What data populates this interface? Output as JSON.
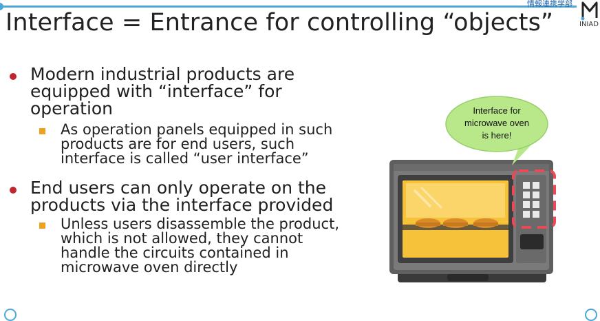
{
  "header": {
    "title": "Interface = Entrance for controlling “objects”",
    "corner_tag": "情報連携学部",
    "logo_text": "INIAD",
    "accent_color": "#4da6d8"
  },
  "bullets": [
    {
      "lines": [
        "Modern industrial products are",
        "equipped with “interface” for",
        "operation"
      ],
      "sub": {
        "lines": [
          "As operation panels equipped in such",
          "products are for end users, such",
          "interface is called “user interface”"
        ]
      }
    },
    {
      "lines": [
        "End users can only operate on the",
        "products via the interface provided"
      ],
      "sub": {
        "lines": [
          "Unless users disassemble the product,",
          "which is not allowed, they cannot",
          "handle the circuits contained in",
          "microwave oven directly"
        ]
      }
    }
  ],
  "illustration": {
    "callout_lines": [
      "Interface for",
      "microwave oven",
      "is here!"
    ],
    "callout_color": "#b8e88a",
    "highlight_color": "#e84a57",
    "icon": "microwave-oven-icon"
  },
  "colors": {
    "bullet_level1": "#c0262d",
    "bullet_level2": "#f0a020"
  }
}
